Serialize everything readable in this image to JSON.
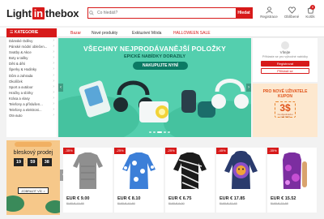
{
  "header": {
    "logo": {
      "part1": "Light",
      "part2": "in",
      "part3": "thebox"
    },
    "search": {
      "placeholder": "Co hledáš?",
      "button_label": "Hledat"
    },
    "icons": [
      {
        "name": "user-icon",
        "label": "Registrace"
      },
      {
        "name": "heart-icon",
        "label": "Oblíbené"
      },
      {
        "name": "cart-icon",
        "label": "Košík",
        "badge": "0"
      }
    ]
  },
  "nav": {
    "categories_label": "KATEGORIE",
    "items": [
      {
        "label": "Bazar",
        "active": true
      },
      {
        "label": "Nové produkty",
        "active": false
      },
      {
        "label": "Exkluzivní Móda",
        "active": false
      },
      {
        "label": "HALLOWEEN SALE",
        "active": true
      }
    ]
  },
  "categories": [
    "Dámské Oděvy",
    "Pánské módní oblečen...",
    "Svatby & Akce",
    "Boty a tašky",
    "Děti & děti",
    "Šperky & Hodinky",
    "Dům a zahrada",
    "Okolíček",
    "Sport a outdoor",
    "Hračky a sbírky",
    "Krása a vlasy",
    "Telefony a příslušen...",
    "Telefony a elektroni...",
    "Ots-auto"
  ],
  "banner": {
    "title": "VŠECHNY NEJPRODÁVANĚJŠÍ POLOŽKY",
    "subtitle": "EPICKÉ NABÍDKY DORAZILY",
    "button": "NAKUPUJTE NYNÍ",
    "prev": "‹",
    "next": "›",
    "bg_color": "#54cfae"
  },
  "account": {
    "greeting": "Vítejte",
    "text": "Přihlaste se pro výhodné nabídky",
    "register": "Registrovat",
    "signin": "Přihlásit se"
  },
  "coupon": {
    "line1": "PRO NOVÉ UŽIVATELE",
    "line2": "KUPON",
    "amount": "3$",
    "note": "za objednávku nad 15 $"
  },
  "flash": {
    "title": "bleskový prodej",
    "timer": [
      "19",
      "59",
      "38"
    ],
    "more": "ZOBRAZIT VÍC >"
  },
  "products": [
    {
      "discount": "-35%",
      "price": "EUR € 9.00",
      "old": "EUR € 13.85",
      "image": "grey-knit-sweater"
    },
    {
      "discount": "-25%",
      "price": "EUR € 8.10",
      "old": "EUR € 10.80",
      "image": "blue-floral-blouse"
    },
    {
      "discount": "-25%",
      "price": "EUR € 6.75",
      "old": "EUR € 9.00",
      "image": "black-striped-top"
    },
    {
      "discount": "-45%",
      "price": "EUR € 17.85",
      "old": "EUR € 32.45",
      "image": "lion-print-hoodie"
    },
    {
      "discount": "-35%",
      "price": "EUR € 15.52",
      "old": "EUR € 23.88",
      "image": "purple-print-top"
    }
  ],
  "accent_color": "#d71a1a"
}
